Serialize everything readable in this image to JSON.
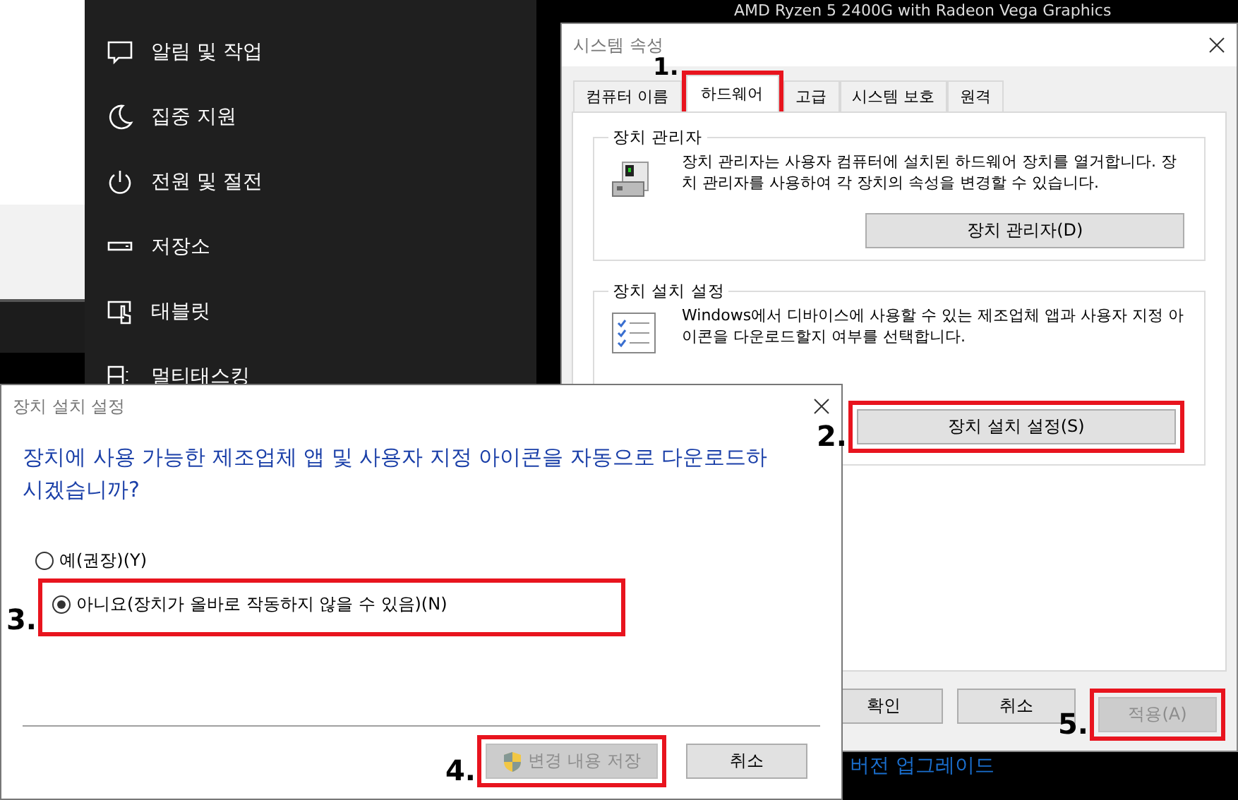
{
  "settings_sidebar": {
    "items": [
      {
        "label": "알림 및 작업"
      },
      {
        "label": "집중 지원"
      },
      {
        "label": "전원 및 절전"
      },
      {
        "label": "저장소"
      },
      {
        "label": "태블릿"
      },
      {
        "label": "멀티태스킹"
      }
    ]
  },
  "cpu_label": "AMD Ryzen 5 2400G with Radeon Vega Graphics",
  "system_properties": {
    "title": "시스템 속성",
    "tabs": [
      {
        "label": "컴퓨터 이름",
        "selected": false
      },
      {
        "label": "하드웨어",
        "selected": true,
        "step": "1."
      },
      {
        "label": "고급",
        "selected": false
      },
      {
        "label": "시스템 보호",
        "selected": false
      },
      {
        "label": "원격",
        "selected": false
      }
    ],
    "device_manager": {
      "title": "장치 관리자",
      "description": "장치 관리자는 사용자 컴퓨터에 설치된 하드웨어 장치를 열거합니다. 장치 관리자를 사용하여 각 장치의 속성을 변경할 수 있습니다.",
      "button": {
        "label": "장치 관리자(D)"
      }
    },
    "device_installation": {
      "title": "장치 설치 설정",
      "description": "Windows에서 디바이스에 사용할 수 있는 제조업체 앱과 사용자 지정 아이콘을 다운로드할지 여부를 선택합니다.",
      "button": {
        "label": "장치 설치 설정(S)",
        "step": "2."
      }
    },
    "buttons": [
      {
        "label": "확인",
        "disabled": false
      },
      {
        "label": "취소",
        "disabled": false
      },
      {
        "label": "적용(A)",
        "disabled": true,
        "step": "5."
      }
    ]
  },
  "background_link": "버전 업그레이드",
  "dialog": {
    "title": "장치 설치 설정",
    "question": "장치에 사용 가능한 제조업체 앱 및 사용자 지정 아이콘을 자동으로 다운로드하시겠습니까?",
    "options": [
      {
        "label": "예(권장)(Y)",
        "selected": false
      },
      {
        "label": "아니요(장치가 올바로 작동하지 않을 수 있음)(N)",
        "selected": true,
        "step": "3."
      }
    ],
    "buttons": [
      {
        "label": "변경 내용 저장",
        "disabled": true,
        "shield": true,
        "step": "4."
      },
      {
        "label": "취소",
        "disabled": false,
        "shield": false
      }
    ]
  }
}
